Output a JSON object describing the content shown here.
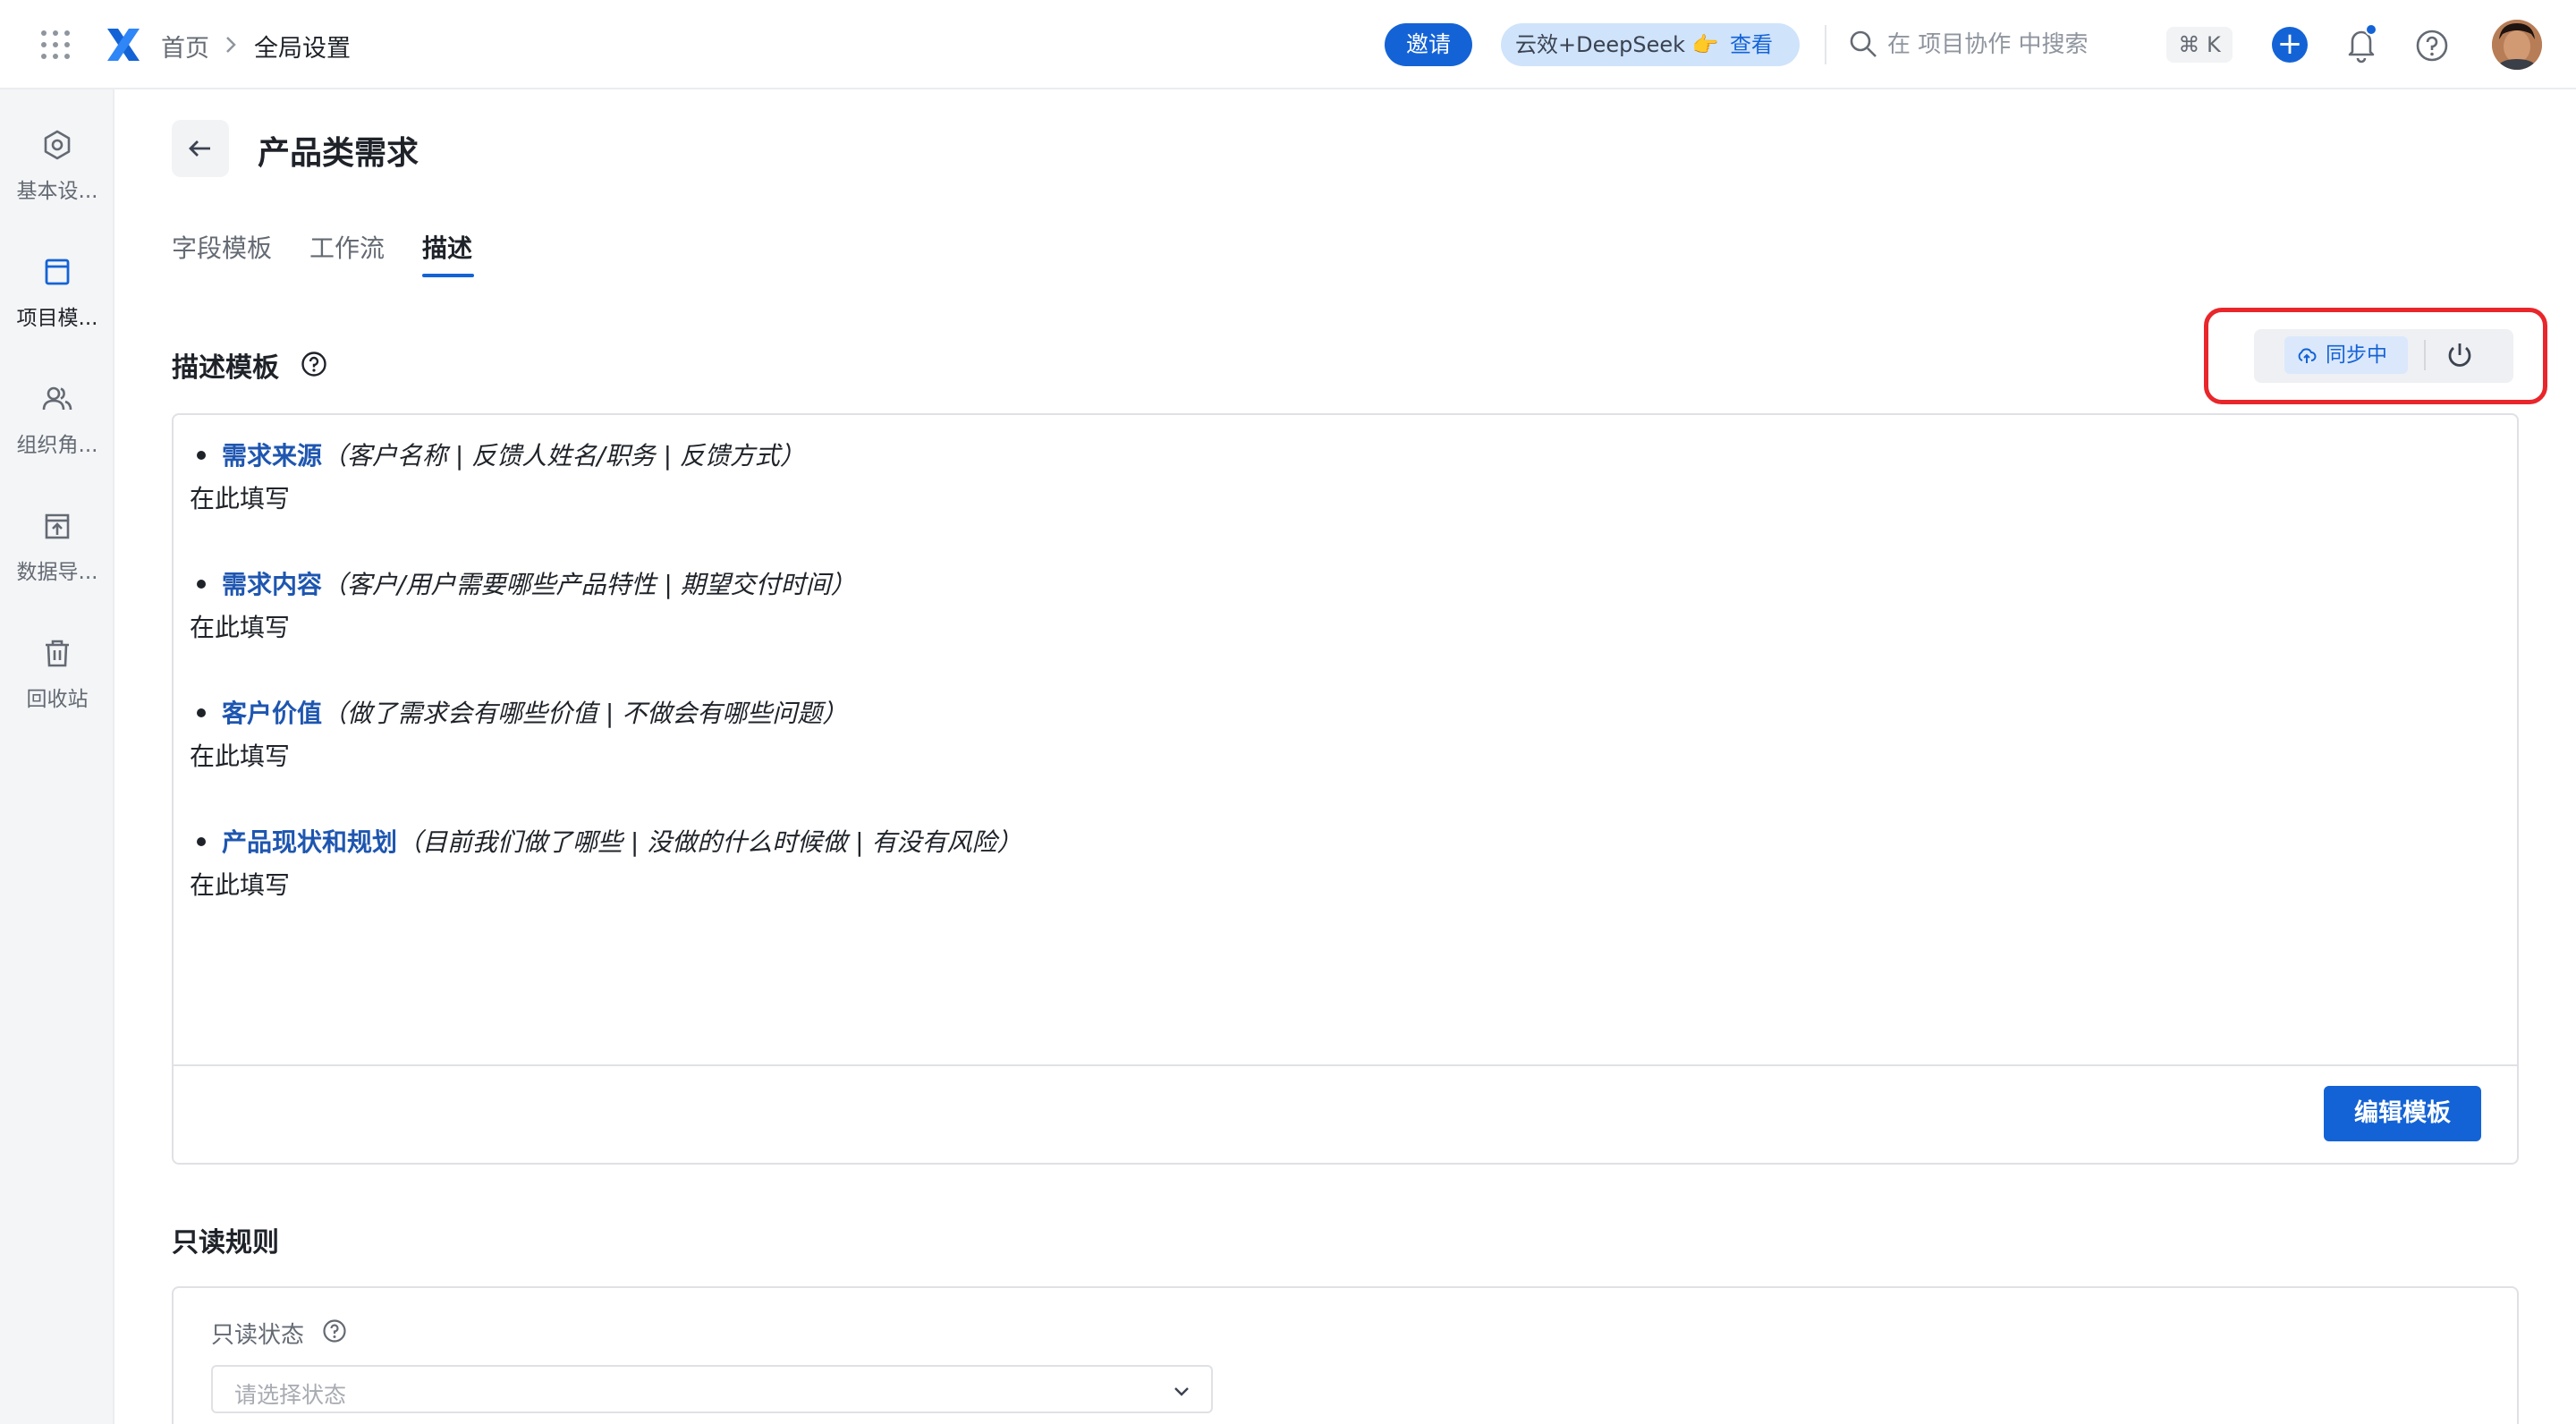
{
  "topbar": {
    "breadcrumb_home": "首页",
    "breadcrumb_current": "全局设置",
    "invite_label": "邀请",
    "promo_text": "云效+DeepSeek 👉",
    "promo_view": "查看",
    "search_placeholder": "在 项目协作 中搜索",
    "shortcut": "⌘ K",
    "add_label": "+",
    "accent": "#1463d6"
  },
  "sidebar": {
    "items": [
      {
        "label": "基本设...",
        "icon": "settings-hex-icon"
      },
      {
        "label": "项目模...",
        "icon": "template-icon"
      },
      {
        "label": "组织角...",
        "icon": "users-icon"
      },
      {
        "label": "数据导...",
        "icon": "import-icon"
      },
      {
        "label": "回收站",
        "icon": "trash-icon"
      }
    ]
  },
  "main": {
    "title": "产品类需求",
    "tabs": [
      "字段模板",
      "工作流",
      "描述"
    ],
    "active_tab": "描述",
    "section_title": "描述模板",
    "sync_label": "同步中",
    "template": [
      {
        "key": "需求来源",
        "hint": "（客户名称 | 反馈人姓名/职务 | 反馈方式）",
        "fill": "在此填写"
      },
      {
        "key": "需求内容",
        "hint": "（客户/用户需要哪些产品特性 | 期望交付时间）",
        "fill": "在此填写"
      },
      {
        "key": "客户价值",
        "hint": "（做了需求会有哪些价值 | 不做会有哪些问题）",
        "fill": "在此填写"
      },
      {
        "key": "产品现状和规划",
        "hint": "（目前我们做了哪些 | 没做的什么时候做 | 有没有风险）",
        "fill": "在此填写"
      }
    ],
    "edit_button": "编辑模板",
    "readonly_title": "只读规则",
    "readonly_state_label": "只读状态",
    "readonly_select_placeholder": "请选择状态"
  }
}
